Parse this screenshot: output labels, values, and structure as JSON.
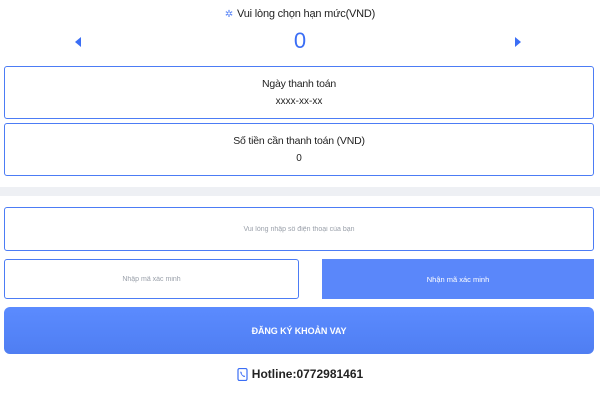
{
  "limit": {
    "title": "Vui lòng chọn hạn mức(VND)",
    "value": "0",
    "icon_left": "triangle-left-icon",
    "icon_right": "triangle-right-icon",
    "title_icon": "snowflake-icon"
  },
  "payment_date": {
    "label": "Ngày thanh toán",
    "value": "xxxx-xx-xx"
  },
  "payment_amount": {
    "label": "Số tiền cần thanh toán (VND)",
    "value": "0"
  },
  "phone": {
    "placeholder": "Vui lòng nhập số điện thoại của bạn",
    "value": ""
  },
  "verification": {
    "placeholder": "Nhập mã xác minh",
    "value": "",
    "button_label": "Nhận mã xác minh"
  },
  "register": {
    "button_label": "ĐĂNG KÝ KHOẢN VAY"
  },
  "hotline": {
    "text": "Hotline:0772981461",
    "icon": "phone-icon"
  },
  "colors": {
    "accent": "#3b6ef5",
    "button": "#5a87fa",
    "border": "#4c7cf5",
    "divider": "#eef0f4"
  }
}
